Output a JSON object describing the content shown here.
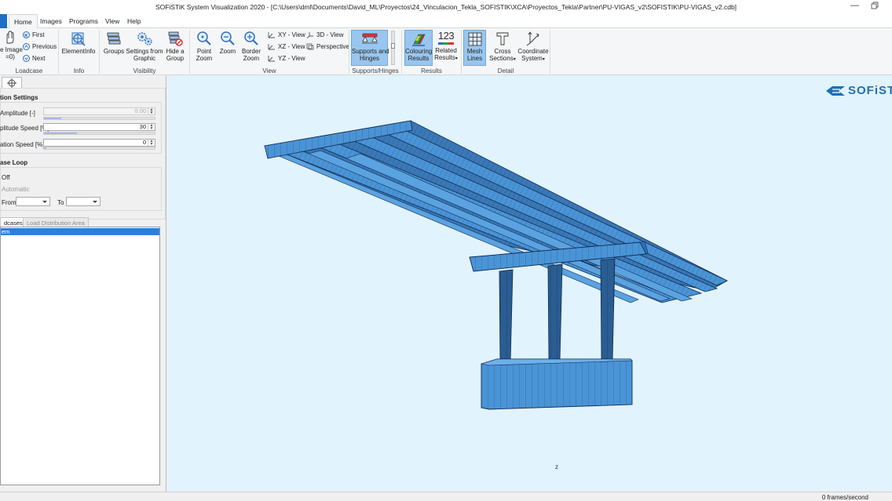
{
  "window": {
    "title": "SOFiSTiK System Visualization 2020 - [C:\\Users\\dml\\Documents\\David_ML\\Proyectos\\24_Vinculacion_Tekla_SOFISTIK\\XCA\\Proyectos_Tekla\\Partner\\PU-VIGAS_v2\\SOFISTIK\\PU-VIGAS_v2.cdb]",
    "minimize_glyph": "—"
  },
  "menu": {
    "tabs": [
      "Home",
      "Images",
      "Programs",
      "View",
      "Help"
    ]
  },
  "ribbon": {
    "loadcase": {
      "label": "Loadcase",
      "image_button_line1": "e Image",
      "image_button_line2": "=0)",
      "first": "First",
      "previous": "Previous",
      "next": "Next"
    },
    "info": {
      "label": "Info",
      "element_info": "ElementInfo"
    },
    "visibility": {
      "label": "Visibility",
      "groups": "Groups",
      "settings_from_graphic_1": "Settings from",
      "settings_from_graphic_2": "Graphic",
      "hide_group_1": "Hide a",
      "hide_group_2": "Group"
    },
    "view": {
      "label": "View",
      "point_zoom_1": "Point",
      "point_zoom_2": "Zoom",
      "zoom": "Zoom",
      "border_zoom_1": "Border",
      "border_zoom_2": "Zoom",
      "xy_view": "XY - View",
      "xz_view": "XZ - View",
      "yz_view": "YZ - View",
      "view_3d": "3D - View",
      "perspective": "Perspective"
    },
    "supports": {
      "label": "Supports/Hinges",
      "supports_1": "Supports and",
      "supports_2": "Hinges"
    },
    "results": {
      "label": "Results",
      "colouring_1": "Colouring",
      "colouring_2": "Results",
      "related_icon_text": "123",
      "related_1": "Related",
      "related_2": "Results"
    },
    "detail": {
      "label": "Detail",
      "mesh_1": "Mesh",
      "mesh_2": "Lines",
      "cross_1": "Cross",
      "cross_2": "Sections",
      "coord_1": "Coordinate",
      "coord_2": "System"
    }
  },
  "left_panel": {
    "animation_settings_title": "tion Settings",
    "amplitude": {
      "label": "Amplitude [-]",
      "value": "0.00"
    },
    "amplitude_speed": {
      "label": "plitude Speed [%]",
      "value": "30",
      "level": 0.3
    },
    "animation_speed": {
      "label": "ation Speed [%]",
      "value": "0",
      "level": 0.0
    },
    "loadcase_loop_title": "ase Loop",
    "off_label": "Off",
    "automatic_label": "Automatic",
    "from_label": "From",
    "to_label": "To",
    "bottom_tabs": [
      "dcases",
      "Load Distribution Area"
    ],
    "list_selected_item": "em"
  },
  "viewport": {
    "logo_text": "SOFiST",
    "axis_label": "z"
  },
  "status": {
    "fps_text": "0 frames/second"
  },
  "colors": {
    "viewport_bg": "#e1f3fd",
    "model_blue": "#4a94d6",
    "model_edge": "#0f2a52",
    "highlight": "#99c6ee",
    "selection": "#2f7fd8"
  }
}
